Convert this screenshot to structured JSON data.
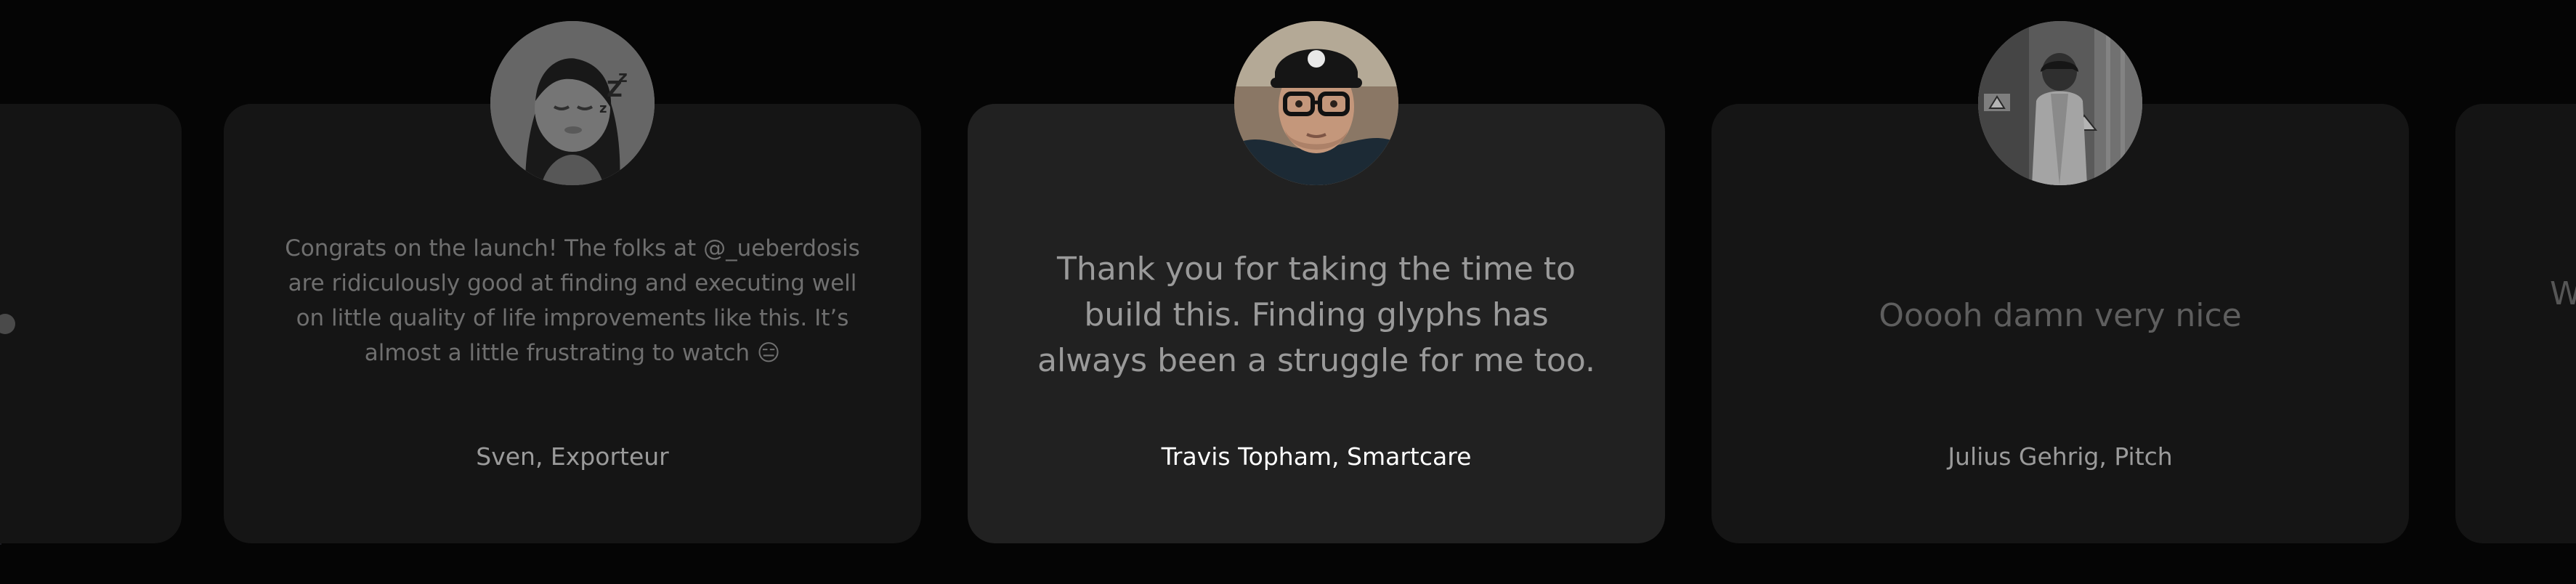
{
  "testimonials": [
    {
      "quote": "",
      "author": ""
    },
    {
      "quote": "Congrats on the launch! The folks at @_ueberdosis are ridiculously good at finding and executing well on little quality of life improvements like this. It’s almost a little frustrating to watch 😑",
      "author": "Sven, Exporteur",
      "avatar": "memoji-avatar"
    },
    {
      "quote": "Thank you for taking the time to build this. Finding glyphs has always been a struggle for me too.",
      "author": "Travis Topham, Smartcare",
      "avatar": "photo-avatar"
    },
    {
      "quote": "Ooooh damn very nice",
      "author": "Julius Gehrig, Pitch",
      "avatar": "photo-avatar"
    },
    {
      "quote": "W",
      "author": ""
    }
  ],
  "colors": {
    "background": "#050505",
    "card_dim": "#151515",
    "card_active": "#212121",
    "text_active": "#ffffff",
    "text_dim": "#9b9b9b"
  }
}
